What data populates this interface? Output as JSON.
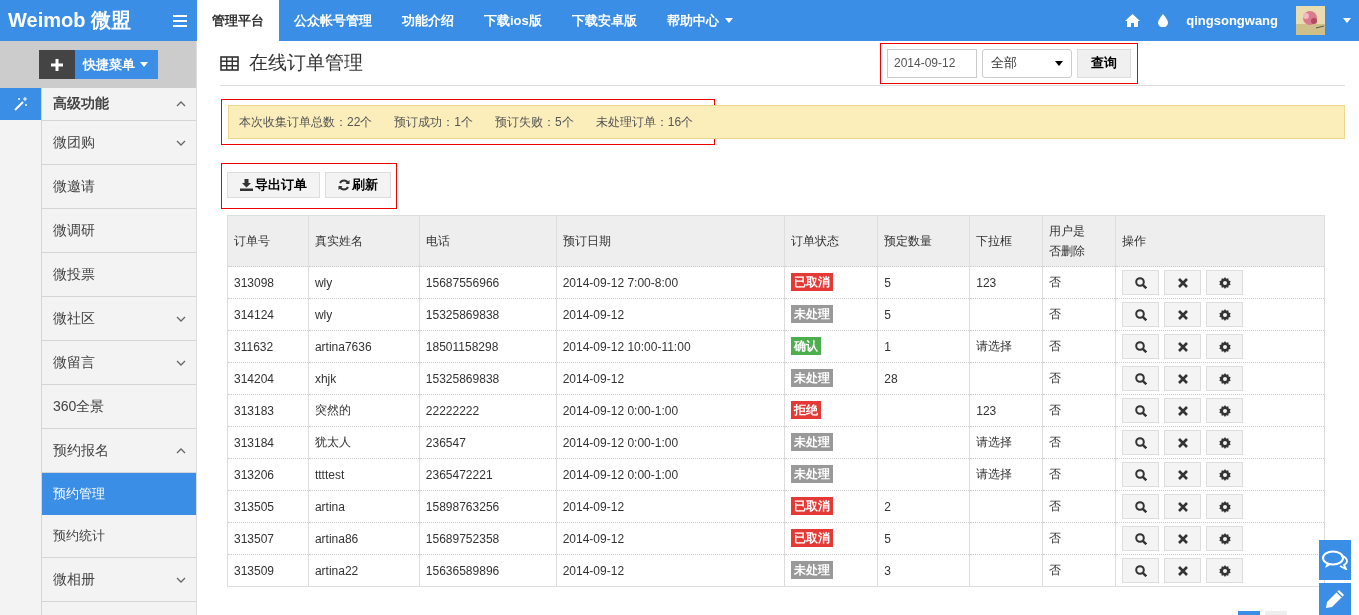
{
  "brand": "Weimob 微盟",
  "top_nav": [
    {
      "label": "管理平台",
      "selected": true
    },
    {
      "label": "公众帐号管理",
      "selected": false
    },
    {
      "label": "功能介绍",
      "selected": false
    },
    {
      "label": "下载ios版",
      "selected": false
    },
    {
      "label": "下载安卓版",
      "selected": false
    },
    {
      "label": "帮助中心",
      "selected": false,
      "dropdown": true
    }
  ],
  "user": {
    "name": "qingsongwang"
  },
  "quick_menu": {
    "label": "快捷菜单"
  },
  "sidebar": {
    "items": [
      {
        "label": "高级功能",
        "expanded": true
      },
      {
        "label": "微团购",
        "expanded": false
      },
      {
        "label": "微邀请"
      },
      {
        "label": "微调研"
      },
      {
        "label": "微投票"
      },
      {
        "label": "微社区",
        "expanded": false
      },
      {
        "label": "微留言",
        "expanded": false
      },
      {
        "label": "360全景"
      },
      {
        "label": "预约报名",
        "expanded": true,
        "children": [
          {
            "label": "预约管理",
            "selected": true
          },
          {
            "label": "预约统计",
            "selected": false
          }
        ]
      },
      {
        "label": "微相册",
        "expanded": false
      }
    ]
  },
  "page_title": "在线订单管理",
  "filter": {
    "date": "2014-09-12",
    "status": "全部",
    "button": "查询"
  },
  "summary": [
    "本次收集订单总数：22个",
    "预订成功：1个",
    "预订失败：5个",
    "未处理订单：16个"
  ],
  "toolbar": [
    {
      "label": "导出订单",
      "kind": "export"
    },
    {
      "label": "刷新",
      "kind": "refresh"
    }
  ],
  "table": {
    "columns": [
      "订单号",
      "真实姓名",
      "电话",
      "预订日期",
      "订单状态",
      "预定数量",
      "下拉框",
      "用户是否删除",
      "操作"
    ],
    "rows": [
      {
        "order_no": "313098",
        "name": "wly",
        "phone": "15687556966",
        "date": "2014-09-12 7:00-8:00",
        "status": "已取消",
        "color": "#e53935",
        "quantity": "5",
        "dropdown": "123",
        "deleted": "否"
      },
      {
        "order_no": "314124",
        "name": "wly",
        "phone": "15325869838",
        "date": "2014-09-12",
        "status": "未处理",
        "color": "#999999",
        "quantity": "5",
        "deleted": "否"
      },
      {
        "order_no": "311632",
        "name": "artina7636",
        "phone": "18501158298",
        "date": "2014-09-12 10:00-11:00",
        "status": "确认",
        "color": "#4cae4c",
        "quantity": "1",
        "dropdown": "请选择",
        "deleted": "否"
      },
      {
        "order_no": "314204",
        "name": "xhjk",
        "phone": "15325869838",
        "date": "2014-09-12",
        "status": "未处理",
        "color": "#999999",
        "quantity": "28",
        "deleted": "否"
      },
      {
        "order_no": "313183",
        "name": "突然的",
        "phone": "22222222",
        "date": "2014-09-12 0:00-1:00",
        "status": "拒绝",
        "color": "#e53935",
        "dropdown": "123",
        "deleted": "否"
      },
      {
        "order_no": "313184",
        "name": "犹太人",
        "phone": "236547",
        "date": "2014-09-12 0:00-1:00",
        "status": "未处理",
        "color": "#999999",
        "dropdown": "请选择",
        "deleted": "否"
      },
      {
        "order_no": "313206",
        "name": "ttttest",
        "phone": "2365472221",
        "date": "2014-09-12 0:00-1:00",
        "status": "未处理",
        "color": "#999999",
        "dropdown": "请选择",
        "deleted": "否"
      },
      {
        "order_no": "313505",
        "name": "artina",
        "phone": "15898763256",
        "date": "2014-09-12",
        "status": "已取消",
        "color": "#e53935",
        "quantity": "2",
        "deleted": "否"
      },
      {
        "order_no": "313507",
        "name": "artina86",
        "phone": "15689752358",
        "date": "2014-09-12",
        "status": "已取消",
        "color": "#e53935",
        "quantity": "5",
        "deleted": "否"
      },
      {
        "order_no": "313509",
        "name": "artina22",
        "phone": "15636589896",
        "date": "2014-09-12",
        "status": "未处理",
        "color": "#999999",
        "quantity": "3",
        "deleted": "否"
      }
    ]
  }
}
